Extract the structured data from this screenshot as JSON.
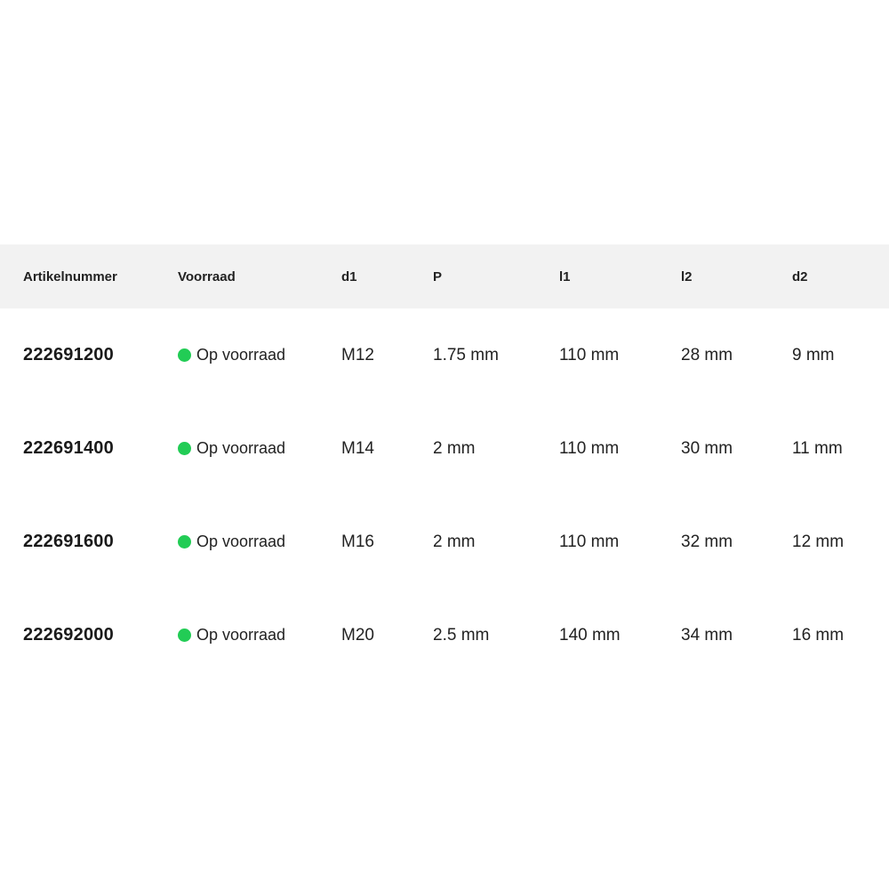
{
  "colors": {
    "header_background": "#f2f2f2",
    "in_stock": "#22cc55",
    "text": "#222222"
  },
  "table": {
    "headers": [
      "Artikelnummer",
      "Voorraad",
      "d1",
      "P",
      "l1",
      "l2",
      "d2"
    ],
    "rows": [
      {
        "article_number": "222691200",
        "stock": "Op voorraad",
        "stock_icon": "green-dot-icon",
        "d1": "M12",
        "p": "1.75 mm",
        "l1": "110 mm",
        "l2": "28 mm",
        "d2": "9 mm"
      },
      {
        "article_number": "222691400",
        "stock": "Op voorraad",
        "stock_icon": "green-dot-icon",
        "d1": "M14",
        "p": "2 mm",
        "l1": "110 mm",
        "l2": "30 mm",
        "d2": "11 mm"
      },
      {
        "article_number": "222691600",
        "stock": "Op voorraad",
        "stock_icon": "green-dot-icon",
        "d1": "M16",
        "p": "2 mm",
        "l1": "110 mm",
        "l2": "32 mm",
        "d2": "12 mm"
      },
      {
        "article_number": "222692000",
        "stock": "Op voorraad",
        "stock_icon": "green-dot-icon",
        "d1": "M20",
        "p": "2.5 mm",
        "l1": "140 mm",
        "l2": "34 mm",
        "d2": "16 mm"
      }
    ]
  }
}
